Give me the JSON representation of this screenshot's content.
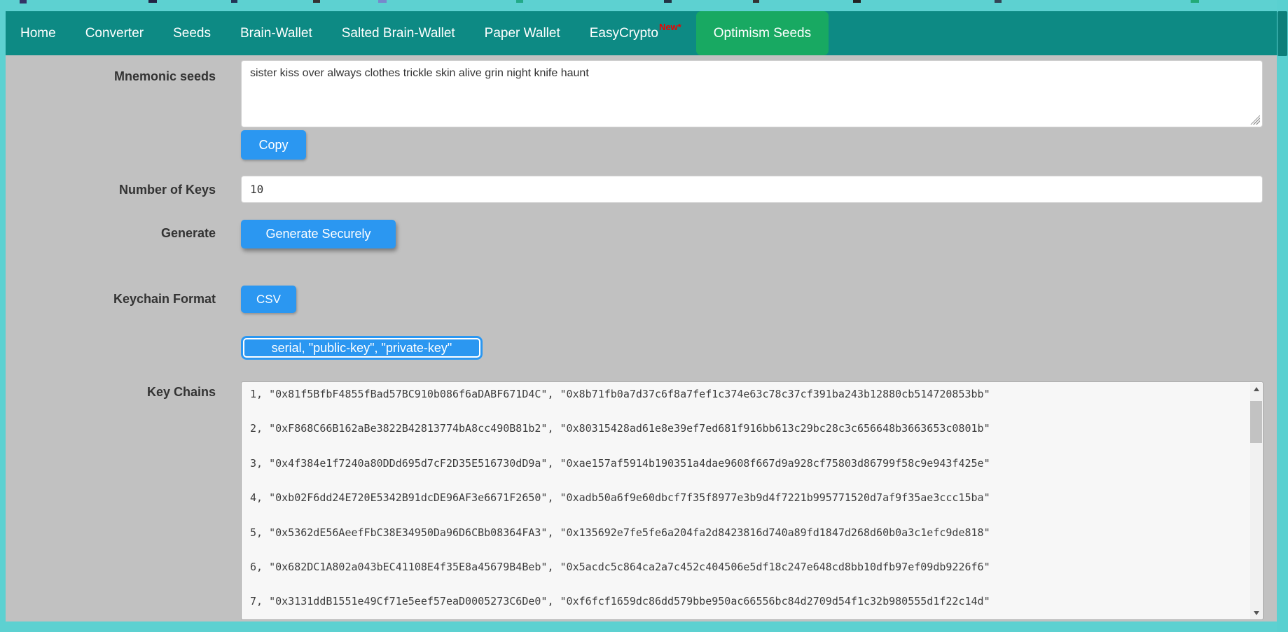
{
  "nav": {
    "items": [
      {
        "label": "Home",
        "active": false
      },
      {
        "label": "Converter",
        "active": false
      },
      {
        "label": "Seeds",
        "active": false
      },
      {
        "label": "Brain-Wallet",
        "active": false
      },
      {
        "label": "Salted Brain-Wallet",
        "active": false
      },
      {
        "label": "Paper Wallet",
        "active": false
      },
      {
        "label": "EasyCrypto",
        "badge": "New*",
        "active": false
      },
      {
        "label": "Optimism Seeds",
        "active": true
      }
    ]
  },
  "form": {
    "mnemonic": {
      "label": "Mnemonic seeds",
      "value": "sister kiss over always clothes trickle skin alive grin night knife haunt",
      "copy_button": "Copy"
    },
    "number_of_keys": {
      "label": "Number of Keys",
      "value": "10"
    },
    "generate": {
      "label": "Generate",
      "button": "Generate Securely"
    },
    "keychain_format": {
      "label": "Keychain Format",
      "selected_format": "CSV",
      "csv_header": "serial, \"public-key\", \"private-key\""
    },
    "key_chains": {
      "label": "Key Chains",
      "rows": [
        "1, \"0x81f5BfbF4855fBad57BC910b086f6aDABF671D4C\", \"0x8b71fb0a7d37c6f8a7fef1c374e63c78c37cf391ba243b12880cb514720853bb\"",
        "2, \"0xF868C66B162aBe3822B42813774bA8cc490B81b2\", \"0x80315428ad61e8e39ef7ed681f916bb613c29bc28c3c656648b3663653c0801b\"",
        "3, \"0x4f384e1f7240a80DDd695d7cF2D35E516730dD9a\", \"0xae157af5914b190351a4dae9608f667d9a928cf75803d86799f58c9e943f425e\"",
        "4, \"0xb02F6dd24E720E5342B91dcDE96AF3e6671F2650\", \"0xadb50a6f9e60dbcf7f35f8977e3b9d4f7221b995771520d7af9f35ae3ccc15ba\"",
        "5, \"0x5362dE56AeefFbC38E34950Da96D6CBb08364FA3\", \"0x135692e7fe5fe6a204fa2d8423816d740a89fd1847d268d60b0a3c1efc9de818\"",
        "6, \"0x682DC1A802a043bEC41108E4f35E8a45679B4Beb\", \"0x5acdc5c864ca2a7c452c404506e5df18c247e648cd8bb10dfb97ef09db9226f6\"",
        "7, \"0x3131ddB1551e49Cf71e5eef57eaD0005273C6De0\", \"0xf6fcf1659dc86dd579bbe950ac66556bc84d2709d54f1c32b980555d1f22c14d\""
      ]
    }
  },
  "colors": {
    "navbar_teal": "#0d8a84",
    "active_tab_green": "#18a962",
    "page_frame_turquoise": "#5dd1d1",
    "content_gray": "#c1c1c1",
    "button_blue": "#2b97f1",
    "badge_red": "#ef0000"
  }
}
